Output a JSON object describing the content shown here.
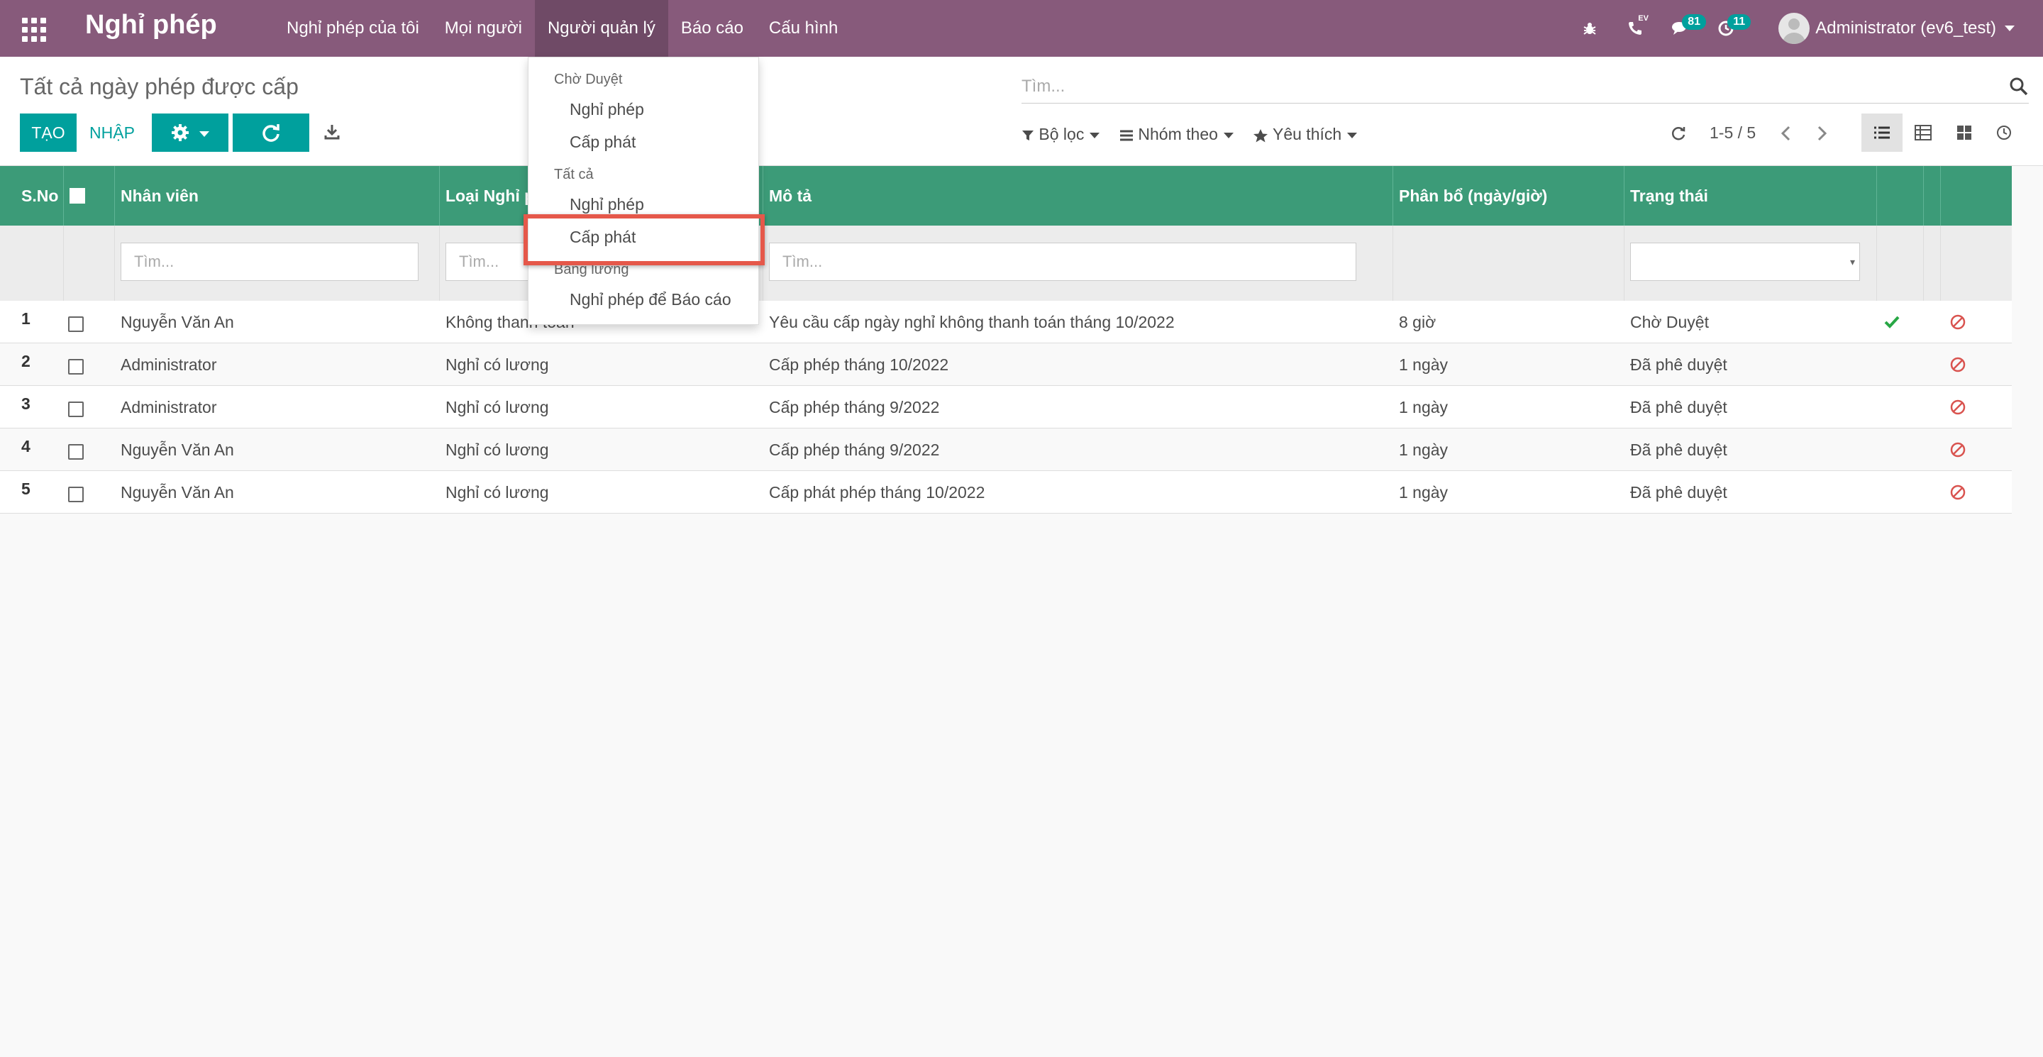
{
  "navbar": {
    "brand": "Nghỉ phép",
    "menu": [
      "Nghỉ phép của tôi",
      "Mọi người",
      "Người quản lý",
      "Báo cáo",
      "Cấu hình"
    ],
    "ev_label": "EV",
    "messages_count": "81",
    "activities_count": "11",
    "user": "Administrator (ev6_test)"
  },
  "control": {
    "breadcrumb": "Tất cả ngày phép được cấp",
    "create": "TẠO",
    "import": "NHẬP",
    "search_placeholder": "Tìm...",
    "filters": "Bộ lọc",
    "group_by": "Nhóm theo",
    "favorites": "Yêu thích",
    "pager": "1-5 / 5"
  },
  "table": {
    "headers": {
      "sno": "S.No",
      "employee": "Nhân viên",
      "leave_type": "Loại Nghỉ p",
      "description": "Mô tả",
      "allocation": "Phân bổ (ngày/giờ)",
      "state": "Trạng thái"
    },
    "filter_placeholder": "Tìm...",
    "rows": [
      {
        "sno": "1",
        "employee": "Nguyễn Văn An",
        "leave_type": "Không thanh toán",
        "description": "Yêu cầu cấp ngày nghỉ không thanh toán tháng 10/2022",
        "allocation": "8 giờ",
        "state": "Chờ Duyệt"
      },
      {
        "sno": "2",
        "employee": "Administrator",
        "leave_type": "Nghỉ có lương",
        "description": "Cấp phép tháng 10/2022",
        "allocation": "1 ngày",
        "state": "Đã phê duyệt"
      },
      {
        "sno": "3",
        "employee": "Administrator",
        "leave_type": "Nghỉ có lương",
        "description": "Cấp phép tháng 9/2022",
        "allocation": "1 ngày",
        "state": "Đã phê duyệt"
      },
      {
        "sno": "4",
        "employee": "Nguyễn Văn An",
        "leave_type": "Nghỉ có lương",
        "description": "Cấp phép tháng 9/2022",
        "allocation": "1 ngày",
        "state": "Đã phê duyệt"
      },
      {
        "sno": "5",
        "employee": "Nguyễn Văn An",
        "leave_type": "Nghỉ có lương",
        "description": "Cấp phát phép tháng 10/2022",
        "allocation": "1 ngày",
        "state": "Đã phê duyệt"
      }
    ]
  },
  "dropdown": {
    "section_pending": "Chờ Duyệt",
    "pending_leave": "Nghỉ phép",
    "pending_allocation": "Cấp phát",
    "section_all": "Tất cả",
    "all_leave": "Nghỉ phép",
    "all_allocation": "Cấp phát",
    "section_payroll": "Bảng lương",
    "payroll_report": "Nghỉ phép để Báo cáo"
  },
  "colors": {
    "navbar": "#875a7b",
    "accent": "#00a09d",
    "table_header": "#3c9b78",
    "highlight": "#e5584a"
  }
}
